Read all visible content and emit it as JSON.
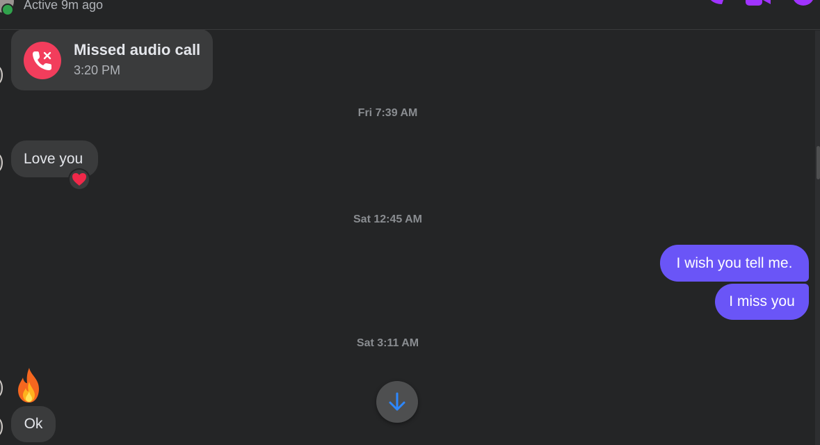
{
  "header": {
    "active_status": "Active 9m ago",
    "icons": [
      "audio-call-icon",
      "video-call-icon",
      "conversation-info-icon"
    ],
    "accent_color": "#a033ff"
  },
  "missed_call": {
    "title": "Missed audio call",
    "time": "3:20 PM",
    "icon": "missed-call-icon",
    "icon_color": "#f23d5c"
  },
  "timestamps": {
    "first": "Fri 7:39 AM",
    "second": "Sat 12:45 AM",
    "third": "Sat 3:11 AM"
  },
  "messages": {
    "love_you": "Love you",
    "love_you_reaction": "heart-reaction-icon",
    "wish_tell": "I wish you tell me.",
    "miss_you": "I miss you",
    "fire": "fire-emoji-icon",
    "ok": "Ok"
  },
  "colors": {
    "background": "#242526",
    "incoming_bubble": "#3a3b3c",
    "outgoing_bubble": "#6a55f7",
    "scroll_arrow": "#2d88ff"
  },
  "scroll_down": {
    "icon": "arrow-down-icon"
  }
}
